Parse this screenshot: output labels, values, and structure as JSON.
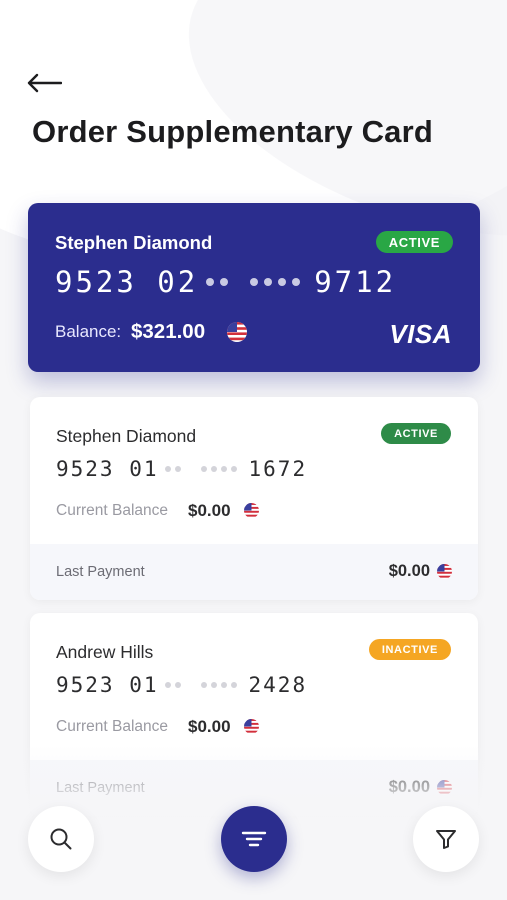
{
  "header": {
    "title": "Order Supplementary Card"
  },
  "primary_card": {
    "holder": "Stephen Diamond",
    "status": "ACTIVE",
    "number_start": "9523 02",
    "number_end": "9712",
    "balance_label": "Balance:",
    "balance_value": "$321.00",
    "brand": "VISA",
    "currency_icon": "us-flag-icon",
    "color": "#2b2d8e"
  },
  "cards": [
    {
      "holder": "Stephen Diamond",
      "status": "ACTIVE",
      "status_color": "#2e8b48",
      "number_start": "9523 01",
      "number_end": "1672",
      "balance_label": "Current Balance",
      "balance_value": "$0.00",
      "last_payment_label": "Last Payment",
      "last_payment_value": "$0.00"
    },
    {
      "holder": "Andrew Hills",
      "status": "INACTIVE",
      "status_color": "#f5a623",
      "number_start": "9523 01",
      "number_end": "2428",
      "balance_label": "Current Balance",
      "balance_value": "$0.00",
      "last_payment_label": "Last Payment",
      "last_payment_value": "$0.00"
    }
  ],
  "bottom_nav": {
    "left_icon": "search-icon",
    "center_icon": "menu-icon",
    "right_icon": "filter-icon"
  },
  "colors": {
    "accent": "#2b2d8e",
    "active_green": "#29a745",
    "inactive_orange": "#f5a623"
  }
}
